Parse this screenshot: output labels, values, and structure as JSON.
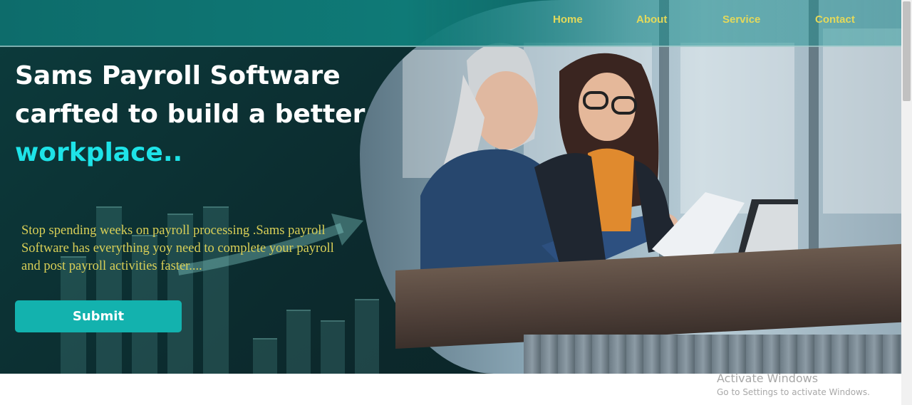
{
  "nav": {
    "home": "Home",
    "about": "About",
    "service": "Service",
    "contact": "Contact"
  },
  "hero": {
    "headline": "Sams Payroll Software carfted to build a better",
    "headline_accent": "workplace..",
    "description": "Stop spending weeks on payroll processing .Sams payroll Software has everything yoy need to complete your payroll and post payroll activities faster....",
    "submit_label": "Submit"
  },
  "watermark": {
    "title": "Activate Windows",
    "subtitle": "Go to Settings to activate Windows."
  },
  "colors": {
    "nav_link": "#e4d95a",
    "accent": "#1ee3e8",
    "button": "#13b2ae",
    "description": "#d9cf57"
  }
}
